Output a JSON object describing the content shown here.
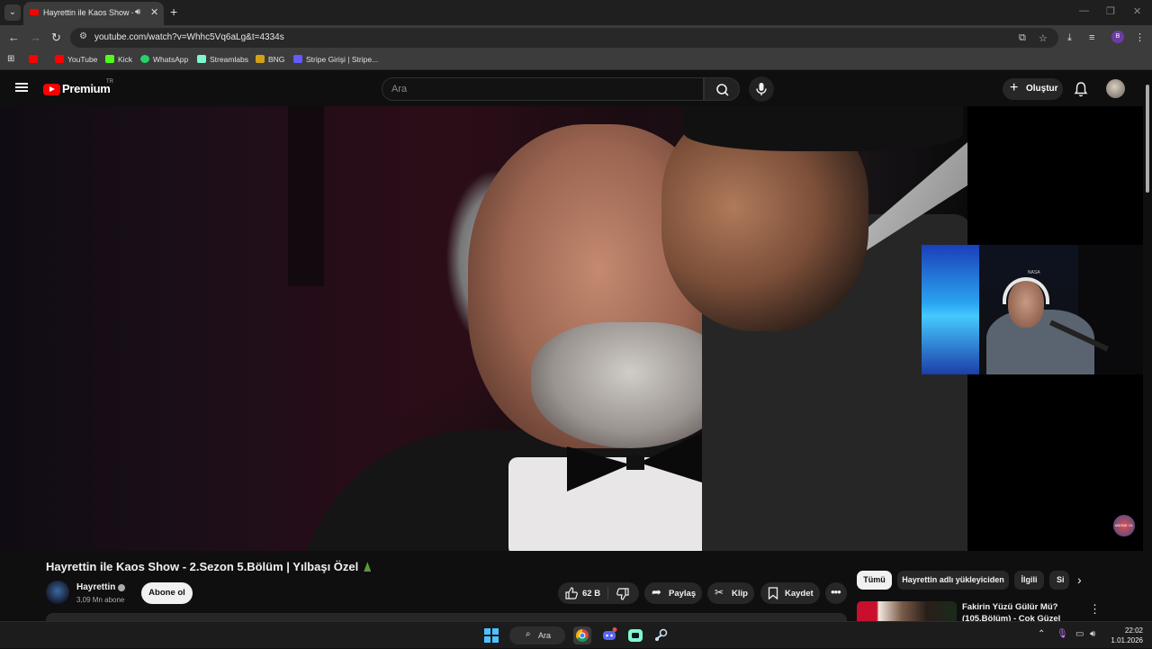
{
  "browser": {
    "tab": {
      "title": "Hayrettin ile Kaos Show - 2",
      "close": "✕"
    },
    "new_tab": "+",
    "url": "youtube.com/watch?v=Whhc5Vq6aLg&t=4334s",
    "profile_initial": "B",
    "bookmarks": [
      {
        "label": "",
        "color": "#ff0000"
      },
      {
        "label": "YouTube",
        "color": "#ff0000"
      },
      {
        "label": "Kick",
        "color": "#53fc18"
      },
      {
        "label": "WhatsApp",
        "color": "#25d366"
      },
      {
        "label": "Streamlabs",
        "color": "#80f5d2"
      },
      {
        "label": "BNG",
        "color": "#d4a017"
      },
      {
        "label": "Stripe Girişi | Stripe...",
        "color": "#635bff"
      }
    ]
  },
  "youtube": {
    "brand": "Premium",
    "region": "TR",
    "search_placeholder": "Ara",
    "create_label": "Oluştur",
    "video": {
      "title": "Hayrettin ile Kaos Show - 2.Sezon 5.Bölüm | Yılbaşı Özel",
      "channel": "Hayrettin",
      "subscribers": "3,09 Mn abone",
      "subscribe_label": "Abone ol",
      "likes": "62 B",
      "share_label": "Paylaş",
      "clip_label": "Klip",
      "save_label": "Kaydet",
      "corner_badge": "ABONE OL"
    },
    "chips": [
      "Tümü",
      "Hayrettin adlı yükleyiciden",
      "İlgili",
      "Si"
    ],
    "recommended": [
      {
        "title": "Fakirin Yüzü Gülür Mü? (105.Bölüm) - Çok Güzel"
      }
    ]
  },
  "webcam": {
    "sticker_text": "NASA"
  },
  "taskbar": {
    "search_label": "Ara",
    "time": "22:02",
    "date": "1.01.2026"
  }
}
